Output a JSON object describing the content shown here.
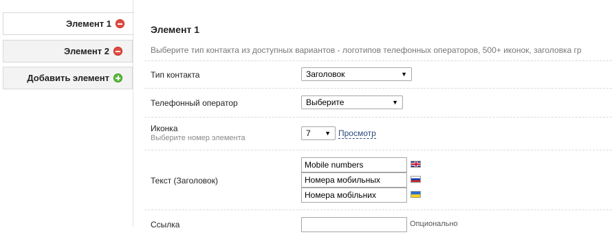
{
  "tabs": [
    {
      "label": "Элемент 1"
    },
    {
      "label": "Элемент 2"
    },
    {
      "label": "Добавить элемент"
    }
  ],
  "main": {
    "title": "Элемент 1",
    "description": "Выберите тип контакта из доступных вариантов - логотипов телефонных операторов, 500+ иконок, заголовка гр",
    "contact_type": {
      "label": "Тип контакта",
      "value": "Заголовок"
    },
    "operator": {
      "label": "Телефонный оператор",
      "value": "Выберите"
    },
    "icon": {
      "label": "Иконка",
      "hint": "Выберите номер элемента",
      "value": "7",
      "preview_link": "Просмотр"
    },
    "text": {
      "label": "Текст (Заголовок)",
      "values": [
        {
          "value": "Mobile numbers",
          "flag": "gb-flag-icon"
        },
        {
          "value": "Номера мобильных",
          "flag": "ru-flag-icon"
        },
        {
          "value": "Номера мобільних",
          "flag": "ua-flag-icon"
        }
      ]
    },
    "link": {
      "label": "Ссылка",
      "value": "",
      "note": "Опционально"
    }
  },
  "icons": {
    "remove": "minus-circle-icon",
    "add": "plus-circle-icon",
    "dropdown": "chevron-down-icon"
  },
  "colors": {
    "remove": "#e14b40",
    "add": "#5cba3c",
    "link": "#2b4a7b"
  }
}
